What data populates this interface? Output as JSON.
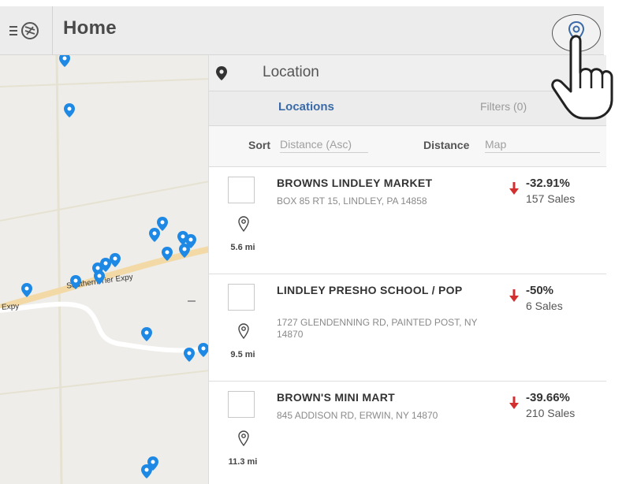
{
  "header": {
    "title": "Home",
    "menu_icon": "hamburger-menu-icon",
    "location_button_icon": "location-pin-icon"
  },
  "map": {
    "road_label": "Southern Tier Expy",
    "road_label_left": "Expy"
  },
  "search": {
    "placeholder": "Location",
    "icon": "map-pin-icon"
  },
  "tabs": {
    "locations": "Locations",
    "filters": "Filters (0)"
  },
  "sort": {
    "sort_label": "Sort",
    "sort_value": "Distance (Asc)",
    "distance_label": "Distance",
    "distance_value": "Map"
  },
  "locations": [
    {
      "name": "BROWNS LINDLEY MARKET",
      "address": "BOX 85 RT 15, LINDLEY, PA 14858",
      "distance": "5.6 mi",
      "change": "-32.91%",
      "sales": "157 Sales"
    },
    {
      "name": "LINDLEY PRESHO SCHOOL / POP",
      "address": "1727 GLENDENNING RD, PAINTED POST, NY 14870",
      "distance": "9.5 mi",
      "change": "-50%",
      "sales": "6 Sales"
    },
    {
      "name": "BROWN'S MINI MART",
      "address": "845 ADDISON RD, ERWIN, NY 14870",
      "distance": "11.3 mi",
      "change": "-39.66%",
      "sales": "210 Sales"
    }
  ],
  "colors": {
    "accent": "#3a6aa8",
    "pin": "#1e88e5",
    "down_arrow": "#d32f2f"
  }
}
